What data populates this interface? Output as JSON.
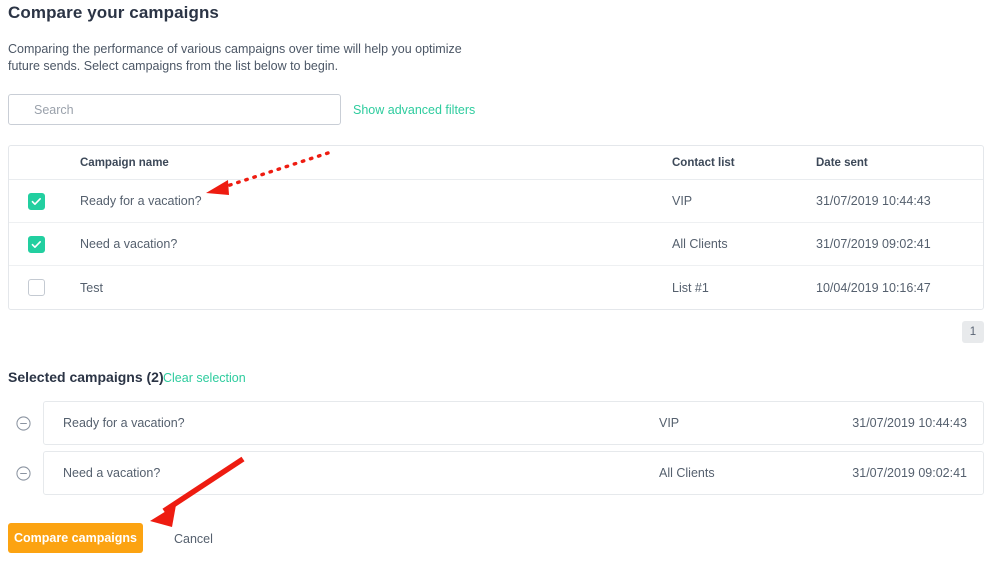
{
  "page": {
    "title": "Compare your campaigns",
    "description": "Comparing the performance of various campaigns over time will help you optimize future sends. Select campaigns from the list below to begin."
  },
  "search": {
    "placeholder": "Search",
    "value": "",
    "advanced_filters_label": "Show advanced filters"
  },
  "table": {
    "columns": {
      "name": "Campaign name",
      "contact_list": "Contact list",
      "date_sent": "Date sent"
    },
    "rows": [
      {
        "checked": true,
        "name": "Ready for a vacation?",
        "contact_list": "VIP",
        "date_sent": "31/07/2019 10:44:43"
      },
      {
        "checked": true,
        "name": "Need a vacation?",
        "contact_list": "All Clients",
        "date_sent": "31/07/2019 09:02:41"
      },
      {
        "checked": false,
        "name": "Test",
        "contact_list": "List #1",
        "date_sent": "10/04/2019 10:16:47"
      }
    ]
  },
  "pagination": {
    "current_page": "1"
  },
  "selected": {
    "title": "Selected campaigns (2)",
    "clear_label": "Clear selection",
    "rows": [
      {
        "name": "Ready for a vacation?",
        "contact_list": "VIP",
        "date_sent": "31/07/2019 10:44:43"
      },
      {
        "name": "Need a vacation?",
        "contact_list": "All Clients",
        "date_sent": "31/07/2019 09:02:41"
      }
    ]
  },
  "footer": {
    "compare_label": "Compare campaigns",
    "cancel_label": "Cancel"
  },
  "colors": {
    "accent_green": "#2ecc9e",
    "checkbox_green": "#22cfa0",
    "primary_orange": "#fca311",
    "annotation_red": "#ee1c11",
    "text": "#3c4858"
  }
}
